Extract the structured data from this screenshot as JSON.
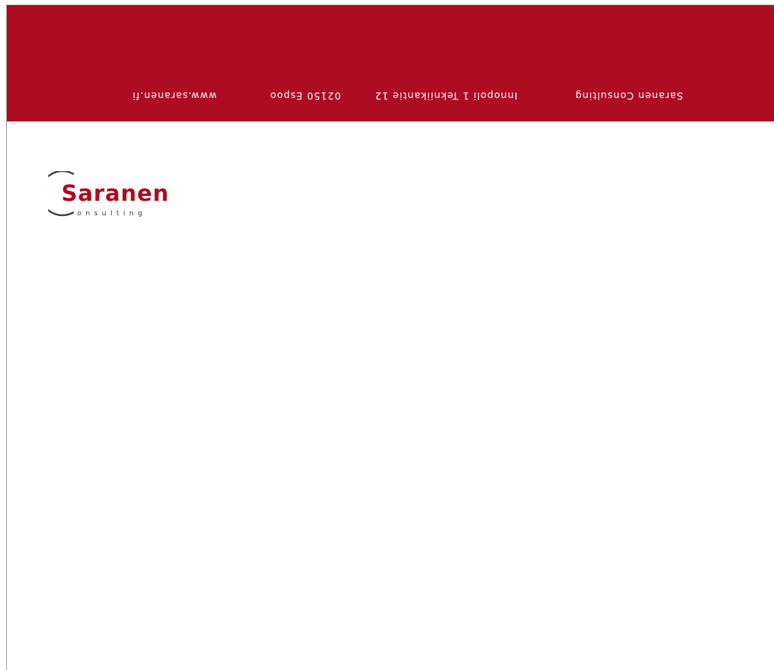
{
  "header": {
    "company": "Saranen Consulting",
    "street": "Innopoli 1   Tekniikantie 12",
    "city": "02150 Espoo",
    "website": "www.saranen.fi"
  },
  "logo": {
    "name": "Saranen",
    "tagline": "onsulting"
  },
  "colors": {
    "brand_red": "#ae0c21",
    "logo_dark": "#3a3a3a",
    "background": "#ffffff"
  }
}
